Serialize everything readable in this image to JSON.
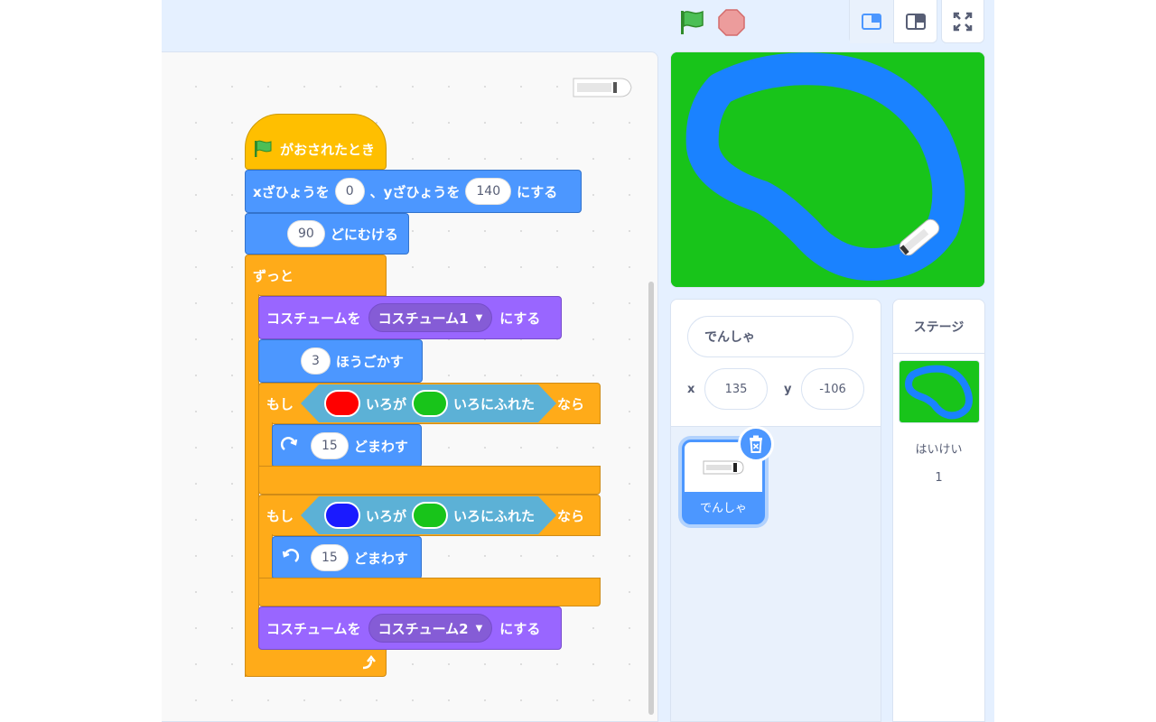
{
  "toolbar": {
    "green_flag": "green-flag-icon",
    "stop": "stop-icon",
    "small_stage_mode": "small-stage-icon",
    "large_stage_mode": "large-stage-icon",
    "fullscreen": "fullscreen-icon"
  },
  "script": {
    "hat_label": "がおされたとき",
    "goto_x_label": "xざひょうを",
    "goto_x_value": "0",
    "goto_sep": "、yざひょうを",
    "goto_y_value": "140",
    "goto_suffix": "にする",
    "point_value": "90",
    "point_label": "どにむける",
    "forever_label": "ずっと",
    "costume1_prefix": "コスチュームを",
    "costume1_value": "コスチューム1",
    "costume1_suffix": "にする",
    "move_value": "3",
    "move_label": "ほうごかす",
    "if1_label": "もし",
    "if1_color_label": "いろが",
    "if1_touch_label": "いろにふれた",
    "if1_then": "なら",
    "if1_color_a": "#ff0000",
    "if1_color_b": "#18c41a",
    "turn_right_value": "15",
    "turn_right_label": "どまわす",
    "if2_label": "もし",
    "if2_color_label": "いろが",
    "if2_touch_label": "いろにふれた",
    "if2_then": "なら",
    "if2_color_a": "#1a1aff",
    "if2_color_b": "#18c41a",
    "turn_left_value": "15",
    "turn_left_label": "どまわす",
    "costume2_prefix": "コスチュームを",
    "costume2_value": "コスチューム2",
    "costume2_suffix": "にする"
  },
  "sprite_info": {
    "name": "でんしゃ",
    "x_label": "x",
    "x_value": "135",
    "y_label": "y",
    "y_value": "-106"
  },
  "sprites": [
    {
      "label": "でんしゃ"
    }
  ],
  "stage_panel": {
    "header": "ステージ",
    "backdrop_label": "はいけい",
    "backdrop_count": "1"
  }
}
